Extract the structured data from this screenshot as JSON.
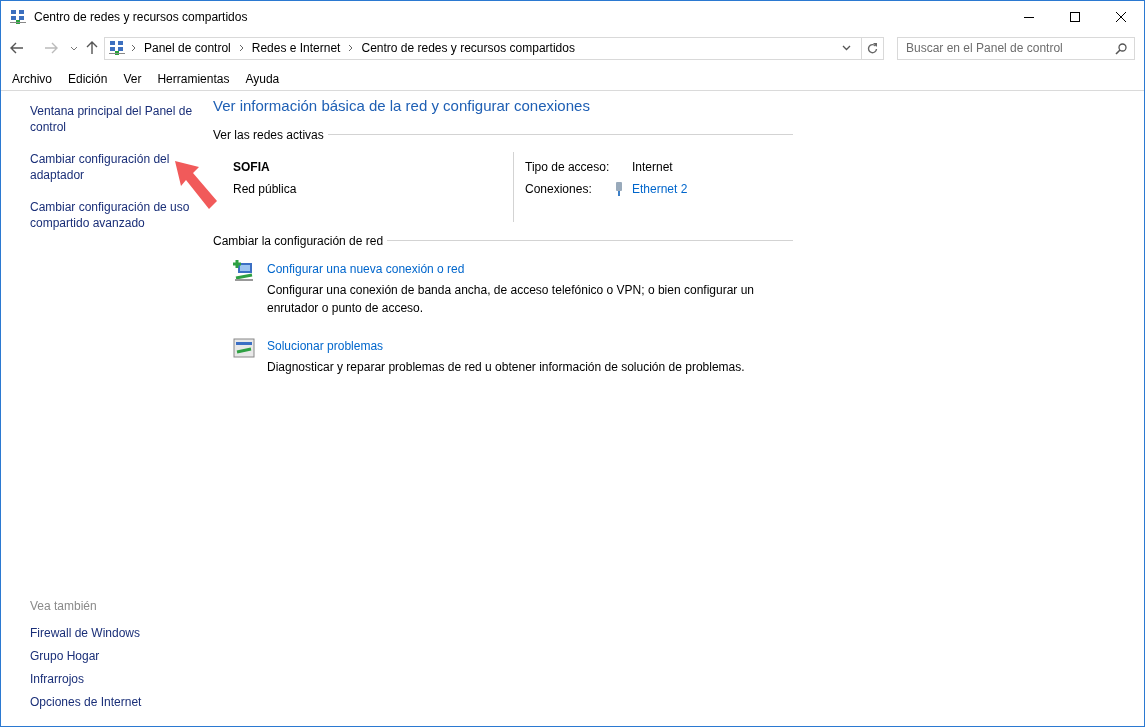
{
  "window": {
    "title": "Centro de redes y recursos compartidos"
  },
  "address_bar": {
    "crumbs": [
      "Panel de control",
      "Redes e Internet",
      "Centro de redes y recursos compartidos"
    ]
  },
  "search": {
    "placeholder": "Buscar en el Panel de control"
  },
  "menu": [
    "Archivo",
    "Edición",
    "Ver",
    "Herramientas",
    "Ayuda"
  ],
  "sidebar": {
    "links": [
      "Ventana principal del Panel de control",
      "Cambiar configuración del adaptador",
      "Cambiar configuración de uso compartido avanzado"
    ],
    "see_also_title": "Vea también",
    "see_also": [
      "Firewall de Windows",
      "Grupo Hogar",
      "Infrarrojos",
      "Opciones de Internet"
    ]
  },
  "main": {
    "heading": "Ver información básica de la red y configurar conexiones",
    "active_section": "Ver las redes activas",
    "network": {
      "name": "SOFIA",
      "type": "Red pública",
      "access_label": "Tipo de acceso:",
      "access_value": "Internet",
      "connections_label": "Conexiones:",
      "connection": "Ethernet 2"
    },
    "change_section": "Cambiar la configuración de red",
    "tasks": [
      {
        "kind": "new",
        "link": "Configurar una nueva conexión o red",
        "description": "Configurar una conexión de banda ancha, de acceso telefónico o VPN; o bien configurar un enrutador o punto de acceso."
      },
      {
        "kind": "troubleshoot",
        "link": "Solucionar problemas",
        "description": "Diagnosticar y reparar problemas de red u obtener información de solución de problemas."
      }
    ]
  }
}
